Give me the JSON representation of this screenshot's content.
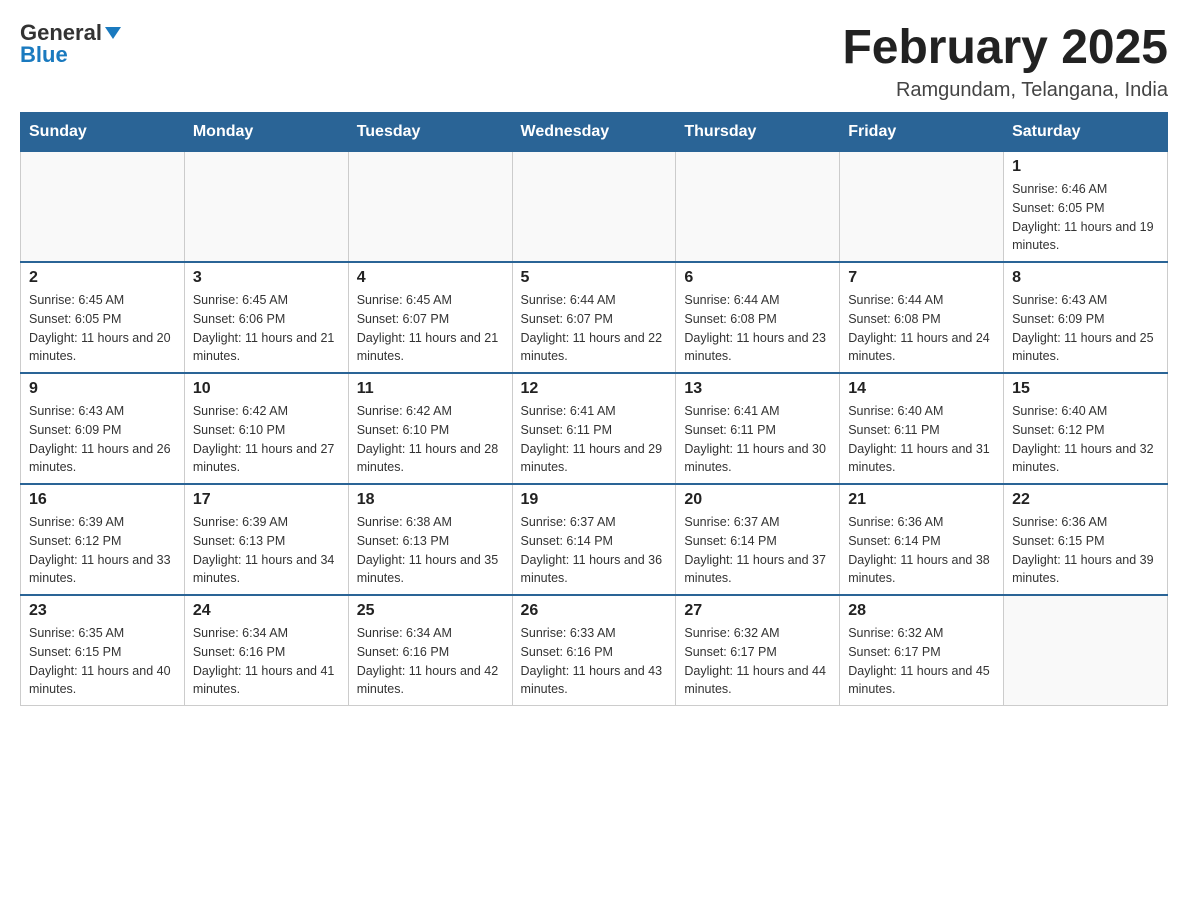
{
  "header": {
    "logo_general": "General",
    "logo_blue": "Blue",
    "month_title": "February 2025",
    "location": "Ramgundam, Telangana, India"
  },
  "weekdays": [
    "Sunday",
    "Monday",
    "Tuesday",
    "Wednesday",
    "Thursday",
    "Friday",
    "Saturday"
  ],
  "weeks": [
    [
      {
        "day": "",
        "sunrise": "",
        "sunset": "",
        "daylight": ""
      },
      {
        "day": "",
        "sunrise": "",
        "sunset": "",
        "daylight": ""
      },
      {
        "day": "",
        "sunrise": "",
        "sunset": "",
        "daylight": ""
      },
      {
        "day": "",
        "sunrise": "",
        "sunset": "",
        "daylight": ""
      },
      {
        "day": "",
        "sunrise": "",
        "sunset": "",
        "daylight": ""
      },
      {
        "day": "",
        "sunrise": "",
        "sunset": "",
        "daylight": ""
      },
      {
        "day": "1",
        "sunrise": "Sunrise: 6:46 AM",
        "sunset": "Sunset: 6:05 PM",
        "daylight": "Daylight: 11 hours and 19 minutes."
      }
    ],
    [
      {
        "day": "2",
        "sunrise": "Sunrise: 6:45 AM",
        "sunset": "Sunset: 6:05 PM",
        "daylight": "Daylight: 11 hours and 20 minutes."
      },
      {
        "day": "3",
        "sunrise": "Sunrise: 6:45 AM",
        "sunset": "Sunset: 6:06 PM",
        "daylight": "Daylight: 11 hours and 21 minutes."
      },
      {
        "day": "4",
        "sunrise": "Sunrise: 6:45 AM",
        "sunset": "Sunset: 6:07 PM",
        "daylight": "Daylight: 11 hours and 21 minutes."
      },
      {
        "day": "5",
        "sunrise": "Sunrise: 6:44 AM",
        "sunset": "Sunset: 6:07 PM",
        "daylight": "Daylight: 11 hours and 22 minutes."
      },
      {
        "day": "6",
        "sunrise": "Sunrise: 6:44 AM",
        "sunset": "Sunset: 6:08 PM",
        "daylight": "Daylight: 11 hours and 23 minutes."
      },
      {
        "day": "7",
        "sunrise": "Sunrise: 6:44 AM",
        "sunset": "Sunset: 6:08 PM",
        "daylight": "Daylight: 11 hours and 24 minutes."
      },
      {
        "day": "8",
        "sunrise": "Sunrise: 6:43 AM",
        "sunset": "Sunset: 6:09 PM",
        "daylight": "Daylight: 11 hours and 25 minutes."
      }
    ],
    [
      {
        "day": "9",
        "sunrise": "Sunrise: 6:43 AM",
        "sunset": "Sunset: 6:09 PM",
        "daylight": "Daylight: 11 hours and 26 minutes."
      },
      {
        "day": "10",
        "sunrise": "Sunrise: 6:42 AM",
        "sunset": "Sunset: 6:10 PM",
        "daylight": "Daylight: 11 hours and 27 minutes."
      },
      {
        "day": "11",
        "sunrise": "Sunrise: 6:42 AM",
        "sunset": "Sunset: 6:10 PM",
        "daylight": "Daylight: 11 hours and 28 minutes."
      },
      {
        "day": "12",
        "sunrise": "Sunrise: 6:41 AM",
        "sunset": "Sunset: 6:11 PM",
        "daylight": "Daylight: 11 hours and 29 minutes."
      },
      {
        "day": "13",
        "sunrise": "Sunrise: 6:41 AM",
        "sunset": "Sunset: 6:11 PM",
        "daylight": "Daylight: 11 hours and 30 minutes."
      },
      {
        "day": "14",
        "sunrise": "Sunrise: 6:40 AM",
        "sunset": "Sunset: 6:11 PM",
        "daylight": "Daylight: 11 hours and 31 minutes."
      },
      {
        "day": "15",
        "sunrise": "Sunrise: 6:40 AM",
        "sunset": "Sunset: 6:12 PM",
        "daylight": "Daylight: 11 hours and 32 minutes."
      }
    ],
    [
      {
        "day": "16",
        "sunrise": "Sunrise: 6:39 AM",
        "sunset": "Sunset: 6:12 PM",
        "daylight": "Daylight: 11 hours and 33 minutes."
      },
      {
        "day": "17",
        "sunrise": "Sunrise: 6:39 AM",
        "sunset": "Sunset: 6:13 PM",
        "daylight": "Daylight: 11 hours and 34 minutes."
      },
      {
        "day": "18",
        "sunrise": "Sunrise: 6:38 AM",
        "sunset": "Sunset: 6:13 PM",
        "daylight": "Daylight: 11 hours and 35 minutes."
      },
      {
        "day": "19",
        "sunrise": "Sunrise: 6:37 AM",
        "sunset": "Sunset: 6:14 PM",
        "daylight": "Daylight: 11 hours and 36 minutes."
      },
      {
        "day": "20",
        "sunrise": "Sunrise: 6:37 AM",
        "sunset": "Sunset: 6:14 PM",
        "daylight": "Daylight: 11 hours and 37 minutes."
      },
      {
        "day": "21",
        "sunrise": "Sunrise: 6:36 AM",
        "sunset": "Sunset: 6:14 PM",
        "daylight": "Daylight: 11 hours and 38 minutes."
      },
      {
        "day": "22",
        "sunrise": "Sunrise: 6:36 AM",
        "sunset": "Sunset: 6:15 PM",
        "daylight": "Daylight: 11 hours and 39 minutes."
      }
    ],
    [
      {
        "day": "23",
        "sunrise": "Sunrise: 6:35 AM",
        "sunset": "Sunset: 6:15 PM",
        "daylight": "Daylight: 11 hours and 40 minutes."
      },
      {
        "day": "24",
        "sunrise": "Sunrise: 6:34 AM",
        "sunset": "Sunset: 6:16 PM",
        "daylight": "Daylight: 11 hours and 41 minutes."
      },
      {
        "day": "25",
        "sunrise": "Sunrise: 6:34 AM",
        "sunset": "Sunset: 6:16 PM",
        "daylight": "Daylight: 11 hours and 42 minutes."
      },
      {
        "day": "26",
        "sunrise": "Sunrise: 6:33 AM",
        "sunset": "Sunset: 6:16 PM",
        "daylight": "Daylight: 11 hours and 43 minutes."
      },
      {
        "day": "27",
        "sunrise": "Sunrise: 6:32 AM",
        "sunset": "Sunset: 6:17 PM",
        "daylight": "Daylight: 11 hours and 44 minutes."
      },
      {
        "day": "28",
        "sunrise": "Sunrise: 6:32 AM",
        "sunset": "Sunset: 6:17 PM",
        "daylight": "Daylight: 11 hours and 45 minutes."
      },
      {
        "day": "",
        "sunrise": "",
        "sunset": "",
        "daylight": ""
      }
    ]
  ]
}
